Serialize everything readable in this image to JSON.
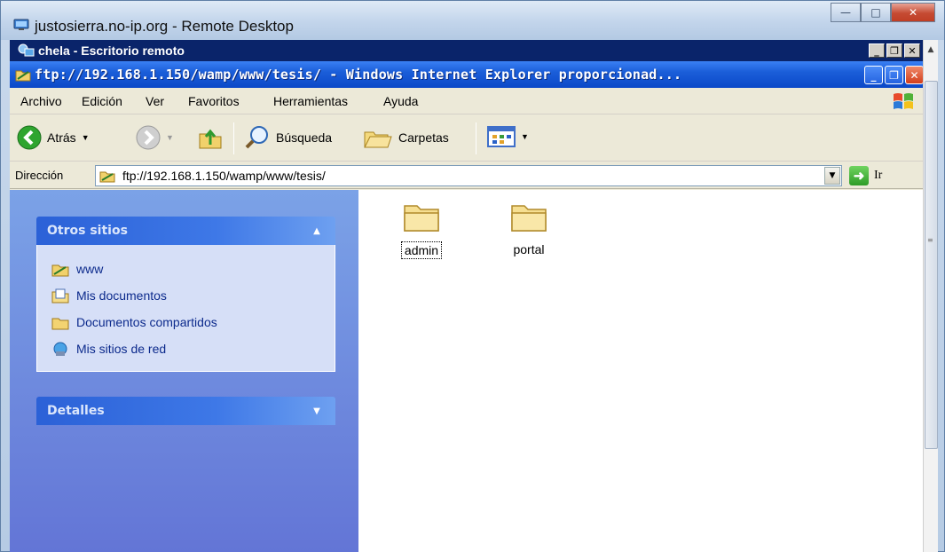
{
  "rd_window": {
    "title": "justosierra.no-ip.org - Remote Desktop",
    "controls": [
      "minimize",
      "maximize",
      "close"
    ]
  },
  "remote_bar": {
    "title": "chela - Escritorio remoto"
  },
  "ie_window": {
    "title": "ftp://192.168.1.150/wamp/www/tesis/ - Windows Internet Explorer proporcionad..."
  },
  "menu": {
    "items": [
      "Archivo",
      "Edición",
      "Ver",
      "Favoritos",
      "Herramientas",
      "Ayuda"
    ]
  },
  "toolbar": {
    "back_label": "Atrás",
    "search_label": "Búsqueda",
    "folders_label": "Carpetas"
  },
  "address": {
    "label": "Dirección",
    "value": "ftp://192.168.1.150/wamp/www/tesis/",
    "go_label": "Ir"
  },
  "taskpane": {
    "other_places": {
      "title": "Otros sitios",
      "links": [
        "www",
        "Mis documentos",
        "Documentos compartidos",
        "Mis sitios de red"
      ]
    },
    "details": {
      "title": "Detalles"
    }
  },
  "files": [
    {
      "name": "admin",
      "type": "folder",
      "selected": true
    },
    {
      "name": "portal",
      "type": "folder",
      "selected": false
    }
  ],
  "colors": {
    "xp_title_blue": "#1b5ed9",
    "taskpane_blue": "#6375d6",
    "link_blue": "#0c2a8c",
    "folder_yellow": "#f3d98a"
  }
}
